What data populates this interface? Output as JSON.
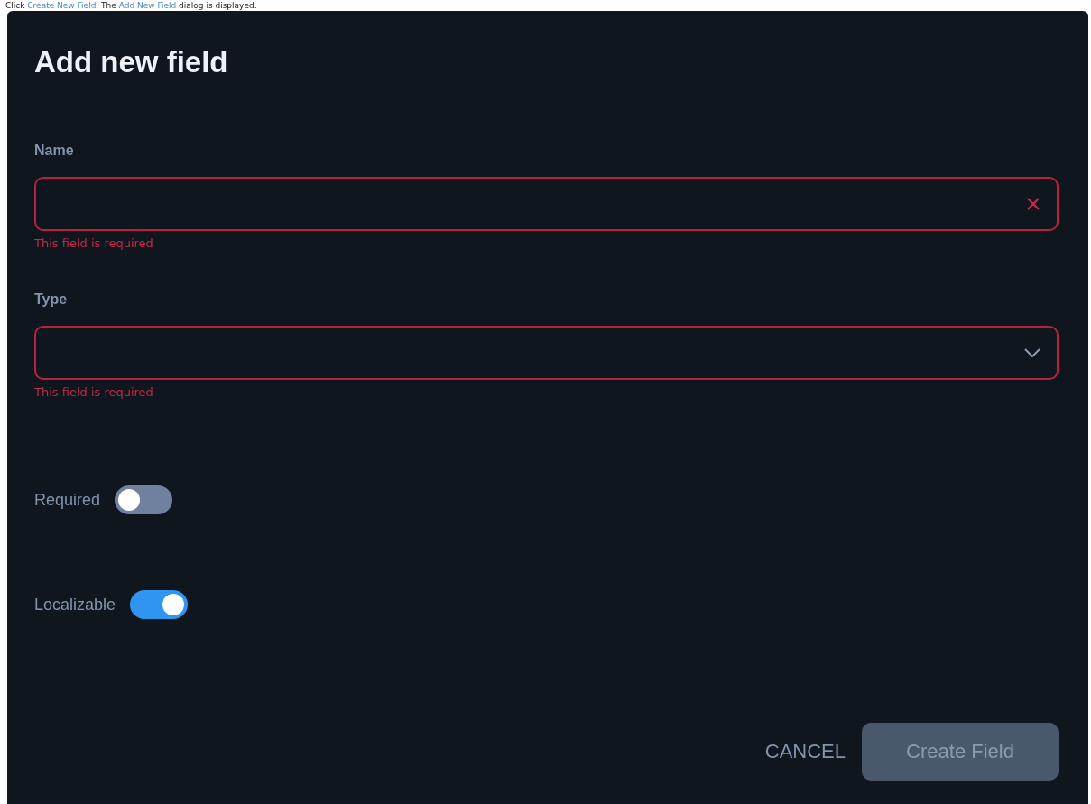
{
  "instruction": [
    {
      "kind": "plain",
      "text": "Click "
    },
    {
      "kind": "link",
      "text": "Create New Field"
    },
    {
      "kind": "plain",
      "text": ". The "
    },
    {
      "kind": "link",
      "text": "Add New Field"
    },
    {
      "kind": "plain",
      "text": " dialog is displayed."
    }
  ],
  "dialog": {
    "title": "Add new field",
    "fields": [
      {
        "label": "Name",
        "kind": "text",
        "error": "This field is required",
        "invalid": true
      },
      {
        "label": "Type",
        "kind": "select",
        "error": "This field is required",
        "invalid": true
      }
    ],
    "toggles": [
      {
        "label": "Required",
        "on": false
      },
      {
        "label": "Localizable",
        "on": true
      }
    ],
    "buttons": [
      {
        "label": "CANCEL",
        "kind": "text"
      },
      {
        "label": "Create Field",
        "kind": "filled",
        "disabled": true
      }
    ]
  }
}
